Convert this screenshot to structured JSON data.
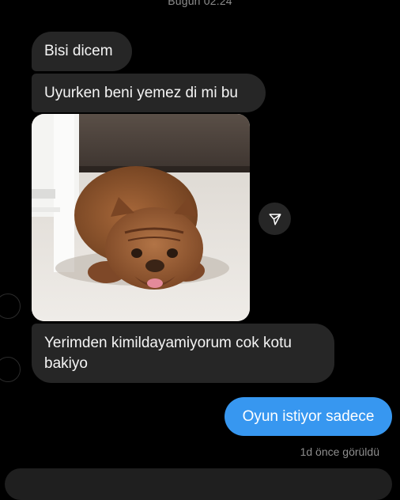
{
  "header": {
    "timestamp": "Bugün 02:24"
  },
  "messages": [
    {
      "text": "Bisi dicem"
    },
    {
      "text": "Uyurken beni yemez di mi bu"
    },
    {
      "text": "Yerimden kimildayamiyorum cok kotu bakiyo"
    }
  ],
  "sent": {
    "text": "Oyun istiyor sadece"
  },
  "status": {
    "seen": "1d önce görüldü"
  },
  "colors": {
    "background": "#000000",
    "incoming_bubble": "#262626",
    "outgoing_bubble": "#3797f0",
    "muted_text": "#8e8e8e"
  },
  "icons": {
    "share": "send-icon"
  }
}
